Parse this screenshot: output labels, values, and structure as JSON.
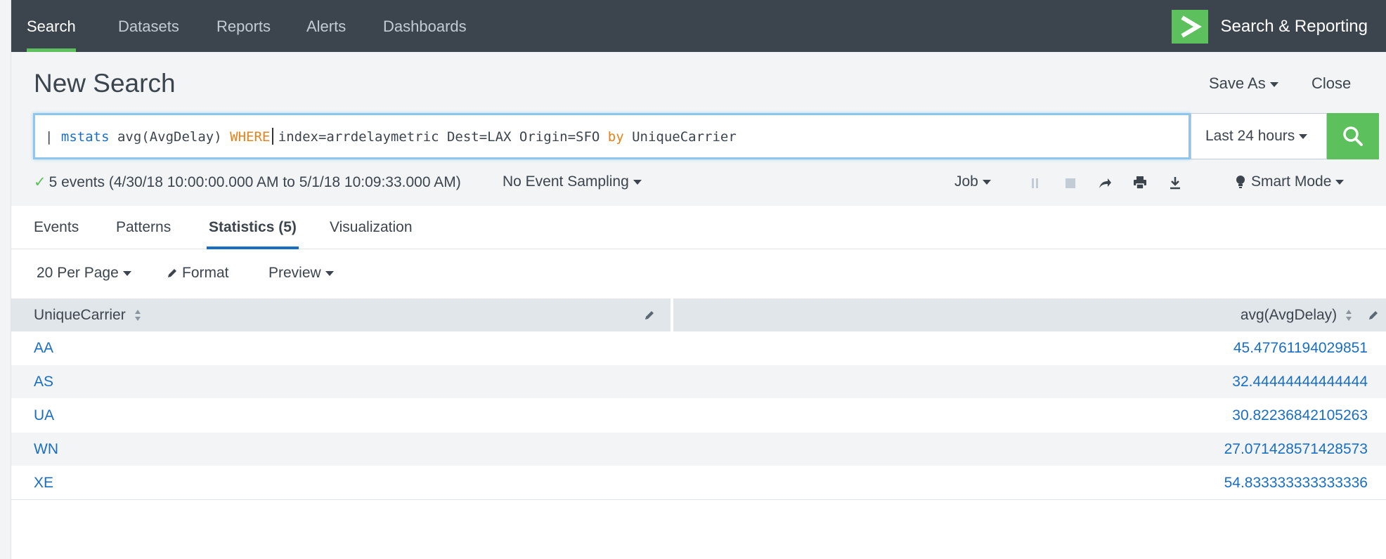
{
  "nav": {
    "items": [
      {
        "label": "Search",
        "active": true
      },
      {
        "label": "Datasets",
        "active": false
      },
      {
        "label": "Reports",
        "active": false
      },
      {
        "label": "Alerts",
        "active": false
      },
      {
        "label": "Dashboards",
        "active": false
      }
    ],
    "app_title": "Search & Reporting"
  },
  "header": {
    "title": "New Search",
    "save_as": "Save As",
    "close": "Close"
  },
  "search": {
    "pipe": "| ",
    "cmd": "mstats",
    "part1": " avg(AvgDelay) ",
    "where": "WHERE",
    "part2": " index=arrdelaymetric Dest=LAX Origin=SFO ",
    "by": "by",
    "part3": " UniqueCarrier",
    "time_range": "Last 24 hours"
  },
  "status": {
    "summary": "5 events (4/30/18 10:00:00.000 AM to 5/1/18 10:09:33.000 AM)",
    "sampling": "No Event Sampling",
    "job": "Job",
    "mode": "Smart Mode"
  },
  "tabs": [
    {
      "label": "Events",
      "active": false
    },
    {
      "label": "Patterns",
      "active": false
    },
    {
      "label": "Statistics (5)",
      "active": true
    },
    {
      "label": "Visualization",
      "active": false
    }
  ],
  "toolbar": {
    "per_page": "20 Per Page",
    "format": "Format",
    "preview": "Preview"
  },
  "table": {
    "columns": [
      "UniqueCarrier",
      "avg(AvgDelay)"
    ],
    "rows": [
      [
        "AA",
        "45.47761194029851"
      ],
      [
        "AS",
        "32.44444444444444"
      ],
      [
        "UA",
        "30.82236842105263"
      ],
      [
        "WN",
        "27.071428571428573"
      ],
      [
        "XE",
        "54.833333333333336"
      ]
    ]
  },
  "colors": {
    "nav_bg": "#3c444d",
    "accent_green": "#5cc05c",
    "link_blue": "#1a6ec2",
    "keyword_orange": "#e5821b"
  }
}
